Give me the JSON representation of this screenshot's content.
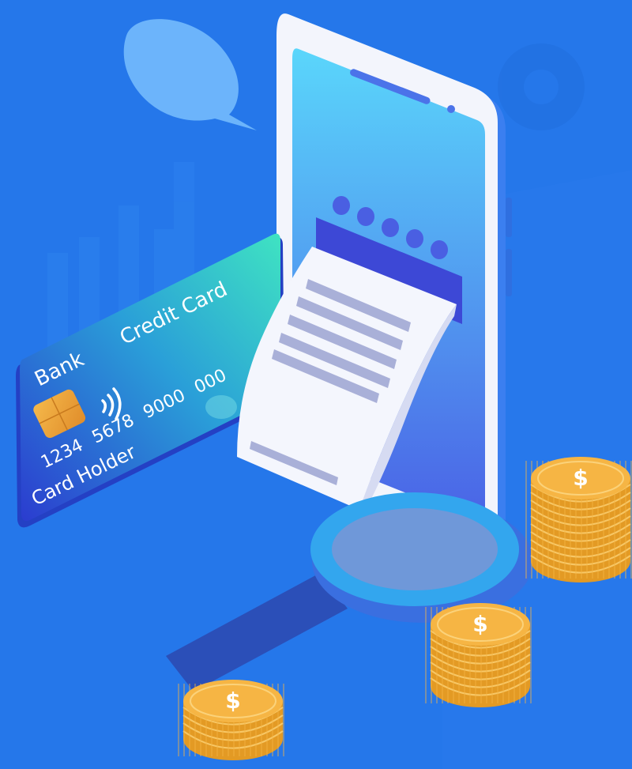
{
  "card": {
    "bank_label": "Bank",
    "type_label": "Credit Card",
    "number_groups": [
      "1234",
      "5678",
      "9000",
      "000"
    ],
    "holder_label": "Card Holder",
    "gradient": [
      "#2b3ccf",
      "#3fe3c2"
    ]
  },
  "phone": {
    "screen_gradient": [
      "#5ad6fb",
      "#4a63e6"
    ],
    "pin_dot_count": 5
  },
  "coin_stacks": [
    {
      "name": "coin-stack-right",
      "symbol": "$"
    },
    {
      "name": "coin-stack-middle",
      "symbol": "$"
    },
    {
      "name": "coin-stack-left",
      "symbol": "$"
    }
  ],
  "colors": {
    "background": "#2577ea",
    "coin_gold": "#f6b544",
    "coin_edge": "#e39a24",
    "receipt": "#f4f6fd",
    "receipt_lines": "#a9b0d8"
  }
}
